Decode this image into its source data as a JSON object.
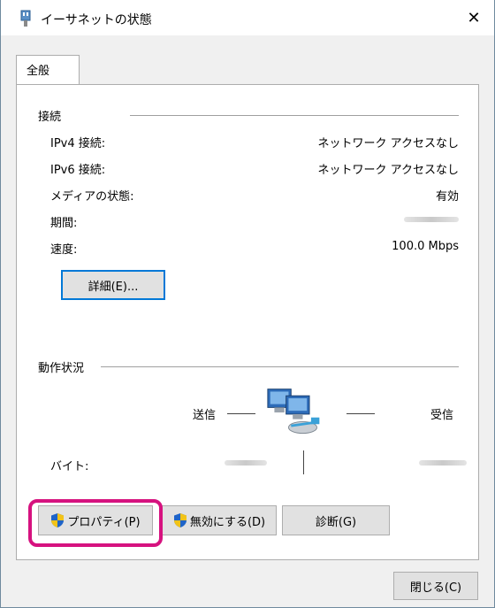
{
  "window": {
    "title": "イーサネットの状態",
    "close_glyph": "✕"
  },
  "tabs": [
    {
      "label": "全般"
    }
  ],
  "connection": {
    "section_title": "接続",
    "rows": [
      {
        "label": "IPv4 接続:",
        "value": "ネットワーク アクセスなし"
      },
      {
        "label": "IPv6 接続:",
        "value": "ネットワーク アクセスなし"
      },
      {
        "label": "メディアの状態:",
        "value": "有効"
      },
      {
        "label": "期間:",
        "value": ""
      },
      {
        "label": "速度:",
        "value": "100.0 Mbps"
      }
    ],
    "details_button": "詳細(E)..."
  },
  "activity": {
    "section_title": "動作状況",
    "sent_label": "送信",
    "received_label": "受信",
    "bytes_label": "バイト:",
    "network_icon": "network-computers-icon"
  },
  "buttons": {
    "properties": "プロパティ(P)",
    "disable": "無効にする(D)",
    "diagnose": "診断(G)",
    "close": "閉じる(C)"
  },
  "colors": {
    "highlight": "#d6127f",
    "focus": "#0078d7",
    "shield_blue": "#1f64c8",
    "shield_yellow": "#f2c318"
  }
}
